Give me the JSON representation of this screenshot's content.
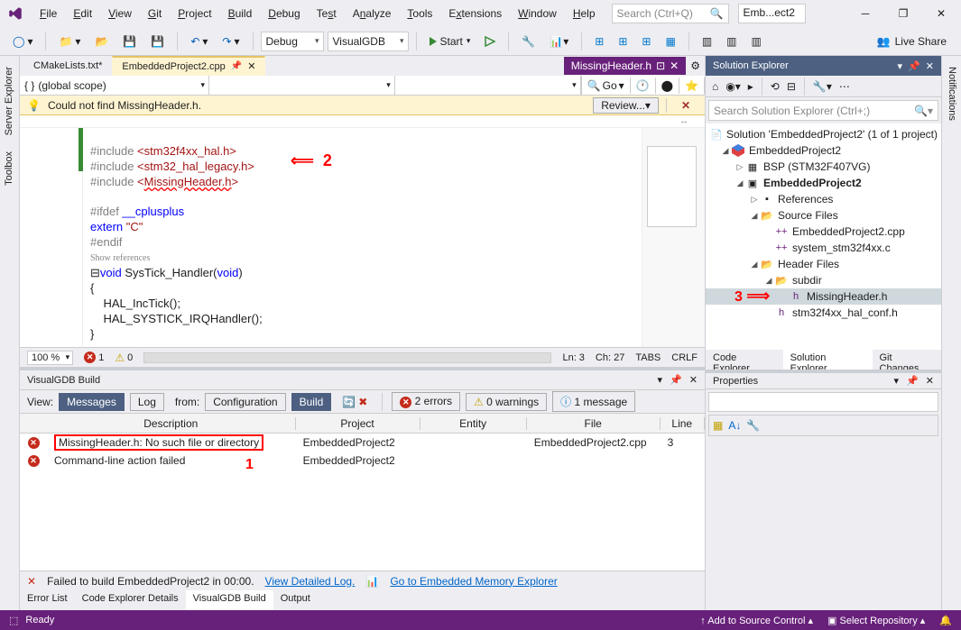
{
  "titlebar": {
    "menus": [
      "File",
      "Edit",
      "View",
      "Git",
      "Project",
      "Build",
      "Debug",
      "Test",
      "Analyze",
      "Tools",
      "Extensions",
      "Window",
      "Help"
    ],
    "search_placeholder": "Search (Ctrl+Q)",
    "solution_short": "Emb...ect2"
  },
  "toolbar": {
    "config": "Debug",
    "platform": "VisualGDB",
    "start": "Start",
    "live_share": "Live Share"
  },
  "left_tabs": [
    "Server Explorer",
    "Toolbox"
  ],
  "right_tabs": [
    "Notifications"
  ],
  "doc_tabs": {
    "file1": "CMakeLists.txt*",
    "file2": "EmbeddedProject2.cpp",
    "preview": "MissingHeader.h"
  },
  "nav": {
    "scope": "(global scope)",
    "go": "Go"
  },
  "info_bar": {
    "msg": "Could not find MissingHeader.h.",
    "review": "Review..."
  },
  "code": {
    "l1a": "#include ",
    "l1b": "<stm32f4xx_hal.h>",
    "l2a": "#include ",
    "l2b": "<stm32_hal_legacy.h>",
    "l3a": "#include ",
    "l3b": "<",
    "l3c": "MissingHeader.h",
    "l3d": ">",
    "l5": "#ifdef ",
    "l5b": "__cplusplus",
    "l6a": "extern ",
    "l6b": "\"C\"",
    "l7": "#endif",
    "ref": "Show references",
    "l9a": "void",
    "l9b": " SysTick_Handler(",
    "l9c": "void",
    "l9d": ")",
    "l10": "{",
    "l11": "    HAL_IncTick();",
    "l12": "    HAL_SYSTICK_IRQHandler();",
    "l13": "}",
    "arrow_label": "2"
  },
  "editor_status": {
    "zoom": "100 %",
    "errors": "1",
    "warnings": "0",
    "ln": "Ln: 3",
    "ch": "Ch: 27",
    "tabs": "TABS",
    "crlf": "CRLF"
  },
  "solution_explorer": {
    "title": "Solution Explorer",
    "search_placeholder": "Search Solution Explorer (Ctrl+;)",
    "root": "Solution 'EmbeddedProject2' (1 of 1 project)",
    "proj": "EmbeddedProject2",
    "bsp": "BSP (STM32F407VG)",
    "proj2": "EmbeddedProject2",
    "refs": "References",
    "src": "Source Files",
    "src1": "EmbeddedProject2.cpp",
    "src2": "system_stm32f4xx.c",
    "hdr": "Header Files",
    "subdir": "subdir",
    "missing": "MissingHeader.h",
    "conf": "stm32f4xx_hal_conf.h",
    "tabs": [
      "Code Explorer",
      "Solution Explorer",
      "Git Changes"
    ],
    "annotation_3": "3"
  },
  "properties": {
    "title": "Properties"
  },
  "build": {
    "title": "VisualGDB Build",
    "view": "View:",
    "messages": "Messages",
    "log": "Log",
    "from": "from:",
    "config": "Configuration",
    "build_btn": "Build",
    "errors": "2 errors",
    "warnings": "0 warnings",
    "info": "1 message",
    "headers": {
      "desc": "Description",
      "proj": "Project",
      "ent": "Entity",
      "file": "File",
      "line": "Line"
    },
    "rows": [
      {
        "desc": "MissingHeader.h: No such file or directory",
        "proj": "EmbeddedProject2",
        "ent": "",
        "file": "EmbeddedProject2.cpp",
        "line": "3"
      },
      {
        "desc": "Command-line action failed",
        "proj": "EmbeddedProject2",
        "ent": "",
        "file": "",
        "line": ""
      }
    ],
    "annotation_1": "1",
    "status_fail": "Failed to build EmbeddedProject2 in 00:00.",
    "view_log": "View Detailed Log.",
    "mem_explorer": "Go to Embedded Memory Explorer",
    "bottom_tabs": [
      "Error List",
      "Code Explorer Details",
      "VisualGDB Build",
      "Output"
    ]
  },
  "statusbar": {
    "ready": "Ready",
    "add_src": "Add to Source Control",
    "select_repo": "Select Repository"
  }
}
